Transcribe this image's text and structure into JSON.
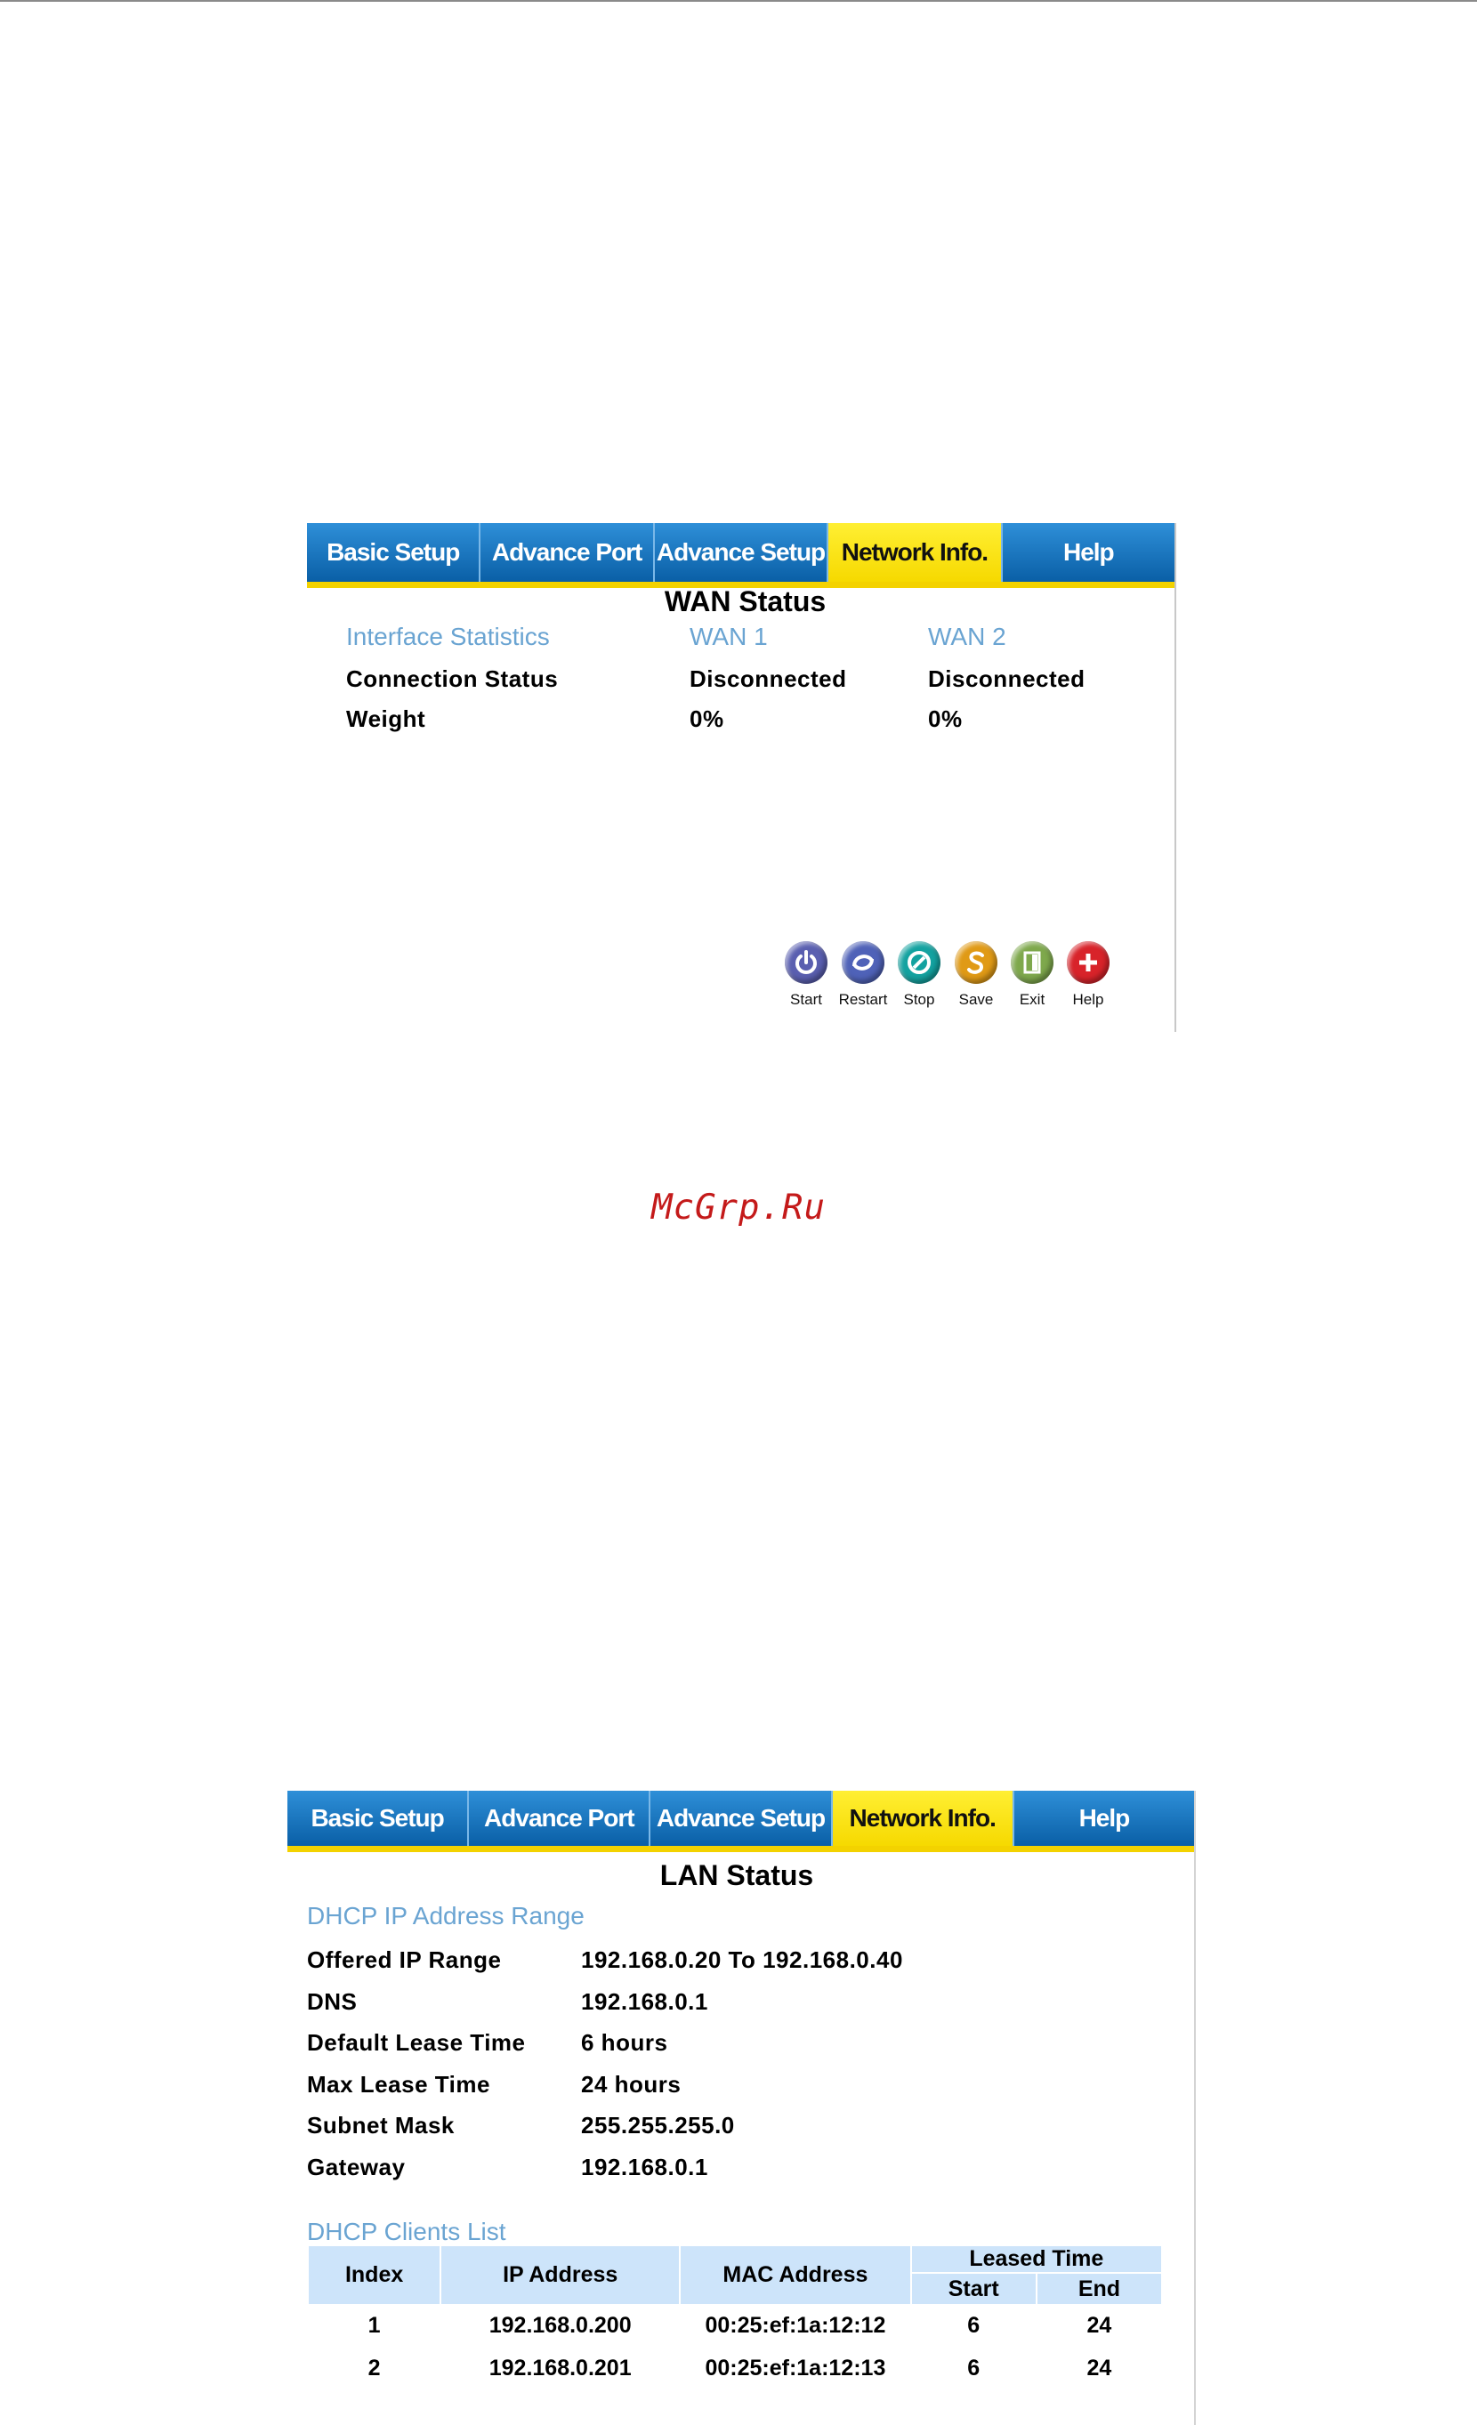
{
  "tabs": [
    "Basic Setup",
    "Advance Port",
    "Advance Setup",
    "Network Info.",
    "Help"
  ],
  "active_tab": "Network Info.",
  "wan": {
    "title": "WAN Status",
    "header_label": "Interface Statistics",
    "col1": "WAN 1",
    "col2": "WAN 2",
    "rows": [
      {
        "label": "Connection Status",
        "wan1": "Disconnected",
        "wan2": "Disconnected"
      },
      {
        "label": "Weight",
        "wan1": "0%",
        "wan2": "0%"
      }
    ],
    "buttons": [
      {
        "label": "Start",
        "icon": "power-icon",
        "color": "#5a5fb0"
      },
      {
        "label": "Restart",
        "icon": "restart-icon",
        "color": "#4f62b8"
      },
      {
        "label": "Stop",
        "icon": "stop-icon",
        "color": "#13a2a0"
      },
      {
        "label": "Save",
        "icon": "save-icon",
        "color": "#e09a16"
      },
      {
        "label": "Exit",
        "icon": "exit-icon",
        "color": "#7ea84c"
      },
      {
        "label": "Help",
        "icon": "plus-icon",
        "color": "#d8232a"
      }
    ]
  },
  "watermark": "McGrp.Ru",
  "lan": {
    "title": "LAN Status",
    "dhcp_range_heading": "DHCP IP Address Range",
    "fields": [
      {
        "label": "Offered IP Range",
        "value": "192.168.0.20 To 192.168.0.40"
      },
      {
        "label": "DNS",
        "value": "192.168.0.1"
      },
      {
        "label": "Default Lease Time",
        "value": "6 hours"
      },
      {
        "label": "Max Lease Time",
        "value": "24 hours"
      },
      {
        "label": "Subnet Mask",
        "value": "255.255.255.0"
      },
      {
        "label": "Gateway",
        "value": "192.168.0.1"
      }
    ],
    "clients_heading": "DHCP Clients List",
    "table": {
      "headers": {
        "index": "Index",
        "ip": "IP Address",
        "mac": "MAC Address",
        "leased": "Leased Time",
        "start": "Start",
        "end": "End"
      },
      "rows": [
        {
          "index": "1",
          "ip": "192.168.0.200",
          "mac": "00:25:ef:1a:12:12",
          "start": "6",
          "end": "24"
        },
        {
          "index": "2",
          "ip": "192.168.0.201",
          "mac": "00:25:ef:1a:12:13",
          "start": "6",
          "end": "24"
        }
      ]
    }
  },
  "colors": {
    "tab_blue": "#0a5fa6",
    "tab_active": "#f6d900",
    "heading_blue": "#6aa4d2",
    "table_header": "#cde4fa",
    "watermark": "#c41a1a"
  }
}
